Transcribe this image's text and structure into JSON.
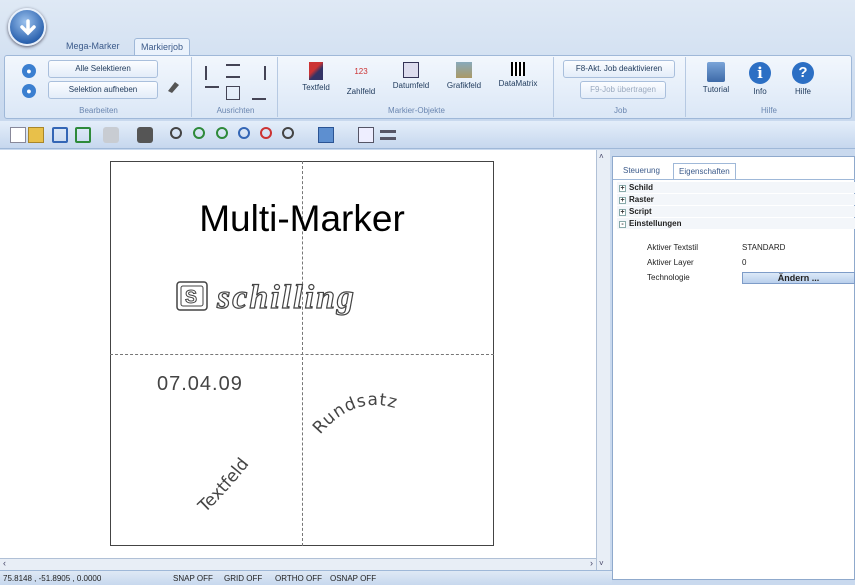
{
  "tabs": [
    "Mega-Marker",
    "Markierjob"
  ],
  "ribbon": {
    "bearbeiten": {
      "select_all": "Alle Selektieren",
      "deselect": "Selektion aufheben",
      "label": "Bearbeiten"
    },
    "ausrichten": {
      "label": "Ausrichten"
    },
    "markier_objekte": {
      "label": "Markier-Objekte",
      "buttons": [
        "Textfeld",
        "Zahlfeld",
        "Datumfeld",
        "Grafikfeld",
        "DataMatrix"
      ]
    },
    "job": {
      "deactivate": "F8-Akt. Job deaktivieren",
      "transfer": "F9-Job übertragen",
      "label": "Job"
    },
    "hilfe": {
      "label": "Hilfe",
      "buttons": [
        "Tutorial",
        "Info",
        "Hilfe"
      ]
    }
  },
  "canvas": {
    "title": "Multi-Marker",
    "logo_text": "schilling",
    "date": "07.04.09",
    "arc_text_1": "Textfeld",
    "arc_text_2": "Rundsatz"
  },
  "panel": {
    "tabs": [
      "Steuerung",
      "Eigenschaften"
    ],
    "categories": [
      {
        "name": "Schild",
        "sign": "+"
      },
      {
        "name": "Raster",
        "sign": "+"
      },
      {
        "name": "Script",
        "sign": "+"
      },
      {
        "name": "Einstellungen",
        "sign": "-"
      }
    ],
    "props": [
      {
        "key": "Aktiver Textstil",
        "value": "STANDARD"
      },
      {
        "key": "Aktiver Layer",
        "value": "0"
      },
      {
        "key": "Technologie",
        "value": ""
      }
    ],
    "change_button": "Ändern ..."
  },
  "status": {
    "coords": "75.8148 , -51.8905 , 0.0000",
    "snap": "SNAP OFF",
    "grid": "GRID OFF",
    "ortho": "ORTHO OFF",
    "osnap": "OSNAP OFF"
  }
}
